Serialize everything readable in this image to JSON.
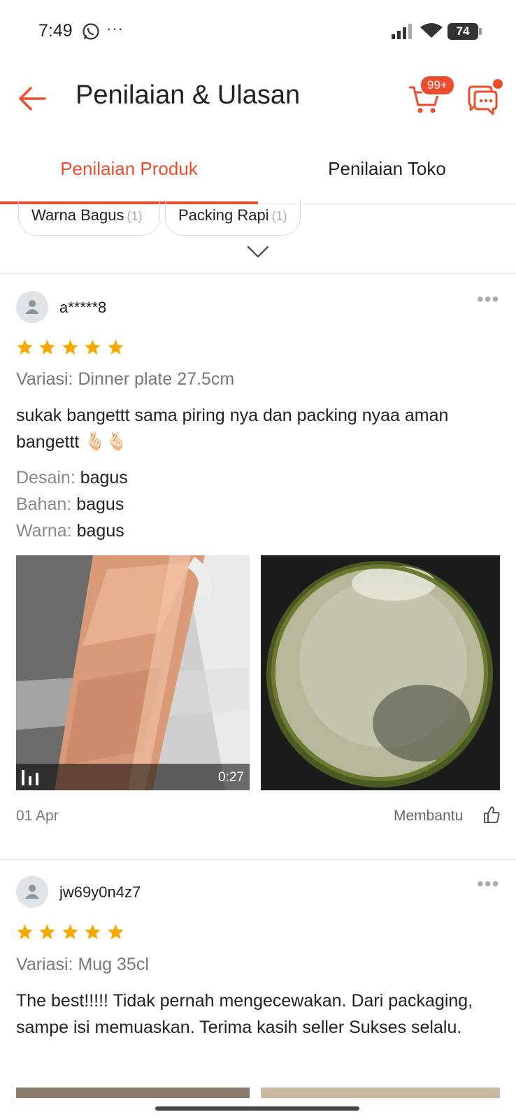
{
  "status_bar": {
    "time": "7:49",
    "more": "···",
    "battery": "74"
  },
  "header": {
    "title": "Penilaian & Ulasan",
    "cart_badge": "99+"
  },
  "tabs": [
    {
      "label": "Penilaian Produk",
      "active": true
    },
    {
      "label": "Penilaian Toko",
      "active": false
    }
  ],
  "filter_chips": [
    {
      "label": "Warna Bagus",
      "count": "(1)"
    },
    {
      "label": "Packing Rapi",
      "count": "(1)"
    }
  ],
  "colors": {
    "accent": "#ee4d2d",
    "star": "#f6a700"
  },
  "reviews": [
    {
      "username": "a*****8",
      "rating": 5,
      "variation": "Variasi: Dinner plate 27.5cm",
      "text": "sukak bangettt sama piring nya dan packing nyaa aman bangettt 🫰🏻🫰🏻",
      "attributes": [
        {
          "key": "Desain:",
          "value": "bagus"
        },
        {
          "key": "Bahan:",
          "value": "bagus"
        },
        {
          "key": "Warna:",
          "value": "bagus"
        }
      ],
      "video_duration": "0:27",
      "date": "01 Apr",
      "helpful_label": "Membantu"
    },
    {
      "username": "jw69y0n4z7",
      "rating": 5,
      "variation": "Variasi: Mug 35cl",
      "text": "The best!!!!! Tidak pernah mengecewakan. Dari packaging, sampe isi memuaskan. Terima kasih seller Sukses selalu."
    }
  ]
}
